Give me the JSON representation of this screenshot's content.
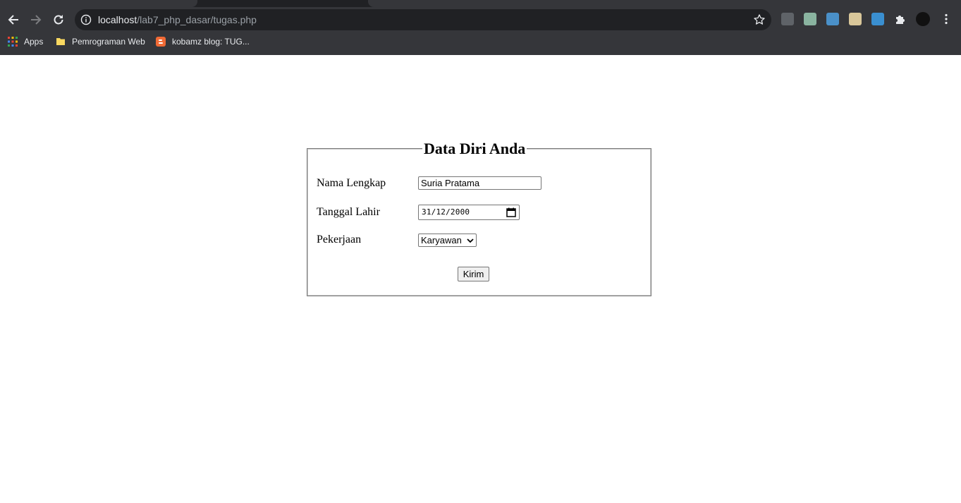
{
  "browser": {
    "url_host": "localhost",
    "url_path": "/lab7_php_dasar/tugas.php",
    "bookmarks": [
      {
        "label": "Apps",
        "icon": "apps-grid-icon"
      },
      {
        "label": "Pemrograman Web",
        "icon": "folder-icon"
      },
      {
        "label": "kobamz blog: TUG...",
        "icon": "blogger-icon"
      }
    ],
    "extension_icons": [
      "extension-1-icon",
      "extension-2-icon",
      "extension-3-icon",
      "extension-4-icon",
      "extension-5-icon",
      "puzzle-icon",
      "avatar-icon",
      "kebab-menu-icon"
    ],
    "colors": {
      "chrome_bg": "#35363a",
      "tabstrip_bg": "#202124",
      "omnibox_bg": "#202124"
    }
  },
  "form": {
    "legend": "Data Diri Anda",
    "fields": [
      {
        "label": "Nama Lengkap",
        "value": "Suria Pratama"
      },
      {
        "label": "Tanggal Lahir",
        "value": "31/12/2000"
      },
      {
        "label": "Pekerjaan",
        "value": "Karyawan"
      }
    ],
    "submit_label": "Kirim"
  }
}
